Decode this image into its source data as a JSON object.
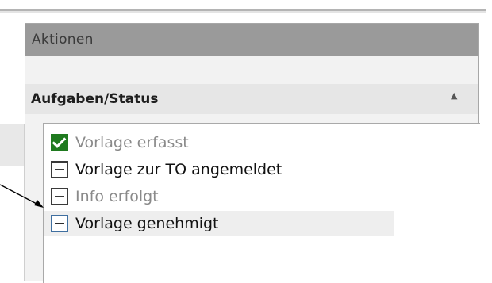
{
  "panel": {
    "title": "Aktionen",
    "section": {
      "title": "Aufgaben/Status",
      "collapse_glyph": "▲"
    },
    "tasks": [
      {
        "label": "Vorlage erfasst",
        "state": "done"
      },
      {
        "label": "Vorlage zur TO angemeldet",
        "state": "open"
      },
      {
        "label": "Info erfolgt",
        "state": "open"
      },
      {
        "label": "Vorlage genehmigt",
        "state": "open"
      }
    ]
  },
  "colors": {
    "check_done": "#1f7a1f",
    "panel_title_bg": "#9a9a9a",
    "section_bg": "#e6e6e6"
  }
}
